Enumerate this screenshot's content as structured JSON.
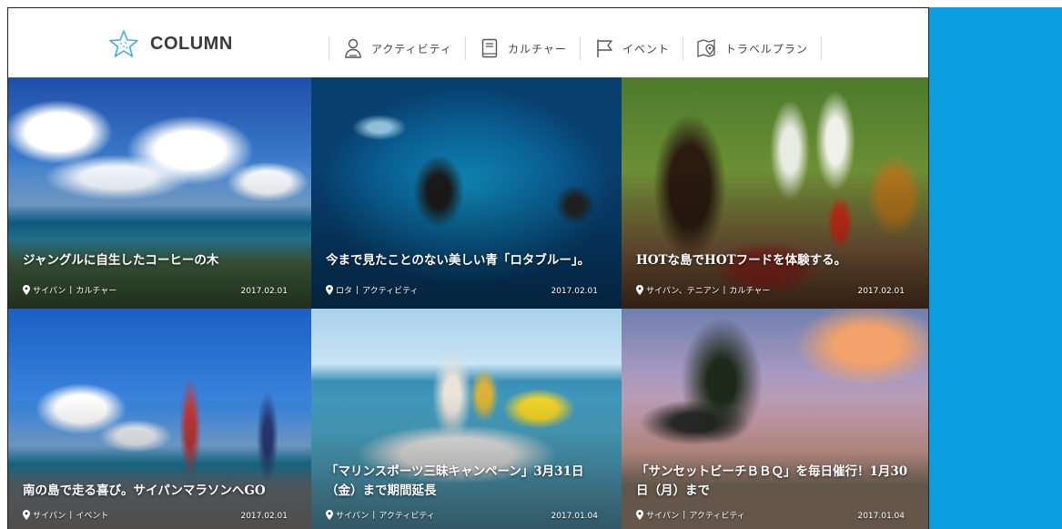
{
  "header": {
    "brand": "COLUMN",
    "nav": [
      {
        "label": "アクティビティ",
        "icon": "person-icon"
      },
      {
        "label": "カルチャー",
        "icon": "book-icon"
      },
      {
        "label": "イベント",
        "icon": "flag-icon"
      },
      {
        "label": "トラベルプラン",
        "icon": "map-pin-icon"
      }
    ]
  },
  "cards": [
    {
      "title": "ジャングルに自生したコーヒーの木",
      "location": "サイパン",
      "category": "カルチャー",
      "date": "2017.02.01"
    },
    {
      "title": "今まで見たことのない美しい青「ロタブルー」。",
      "location": "ロタ",
      "category": "アクティビティ",
      "date": "2017.02.01"
    },
    {
      "title": "HOTな島でHOTフードを体験する。",
      "location": "サイパン、テニアン",
      "category": "カルチャー",
      "date": "2017.02.01"
    },
    {
      "title": "南の島で走る喜び。サイパンマラソンへGO",
      "location": "サイパン",
      "category": "イベント",
      "date": "2017.02.01"
    },
    {
      "title": "「マリンスポーツ三昧キャンペーン」3月31日（金）まで期間延長",
      "location": "サイパン",
      "category": "アクティビティ",
      "date": "2017.01.04"
    },
    {
      "title": "「サンセットビーチＢＢＱ」を毎日催行！1月30日（月）まで",
      "location": "サイパン",
      "category": "アクティビティ",
      "date": "2017.01.04"
    }
  ],
  "colors": {
    "side_panel": "#0a9ee0",
    "brand_icon": "#4aa8d8"
  }
}
